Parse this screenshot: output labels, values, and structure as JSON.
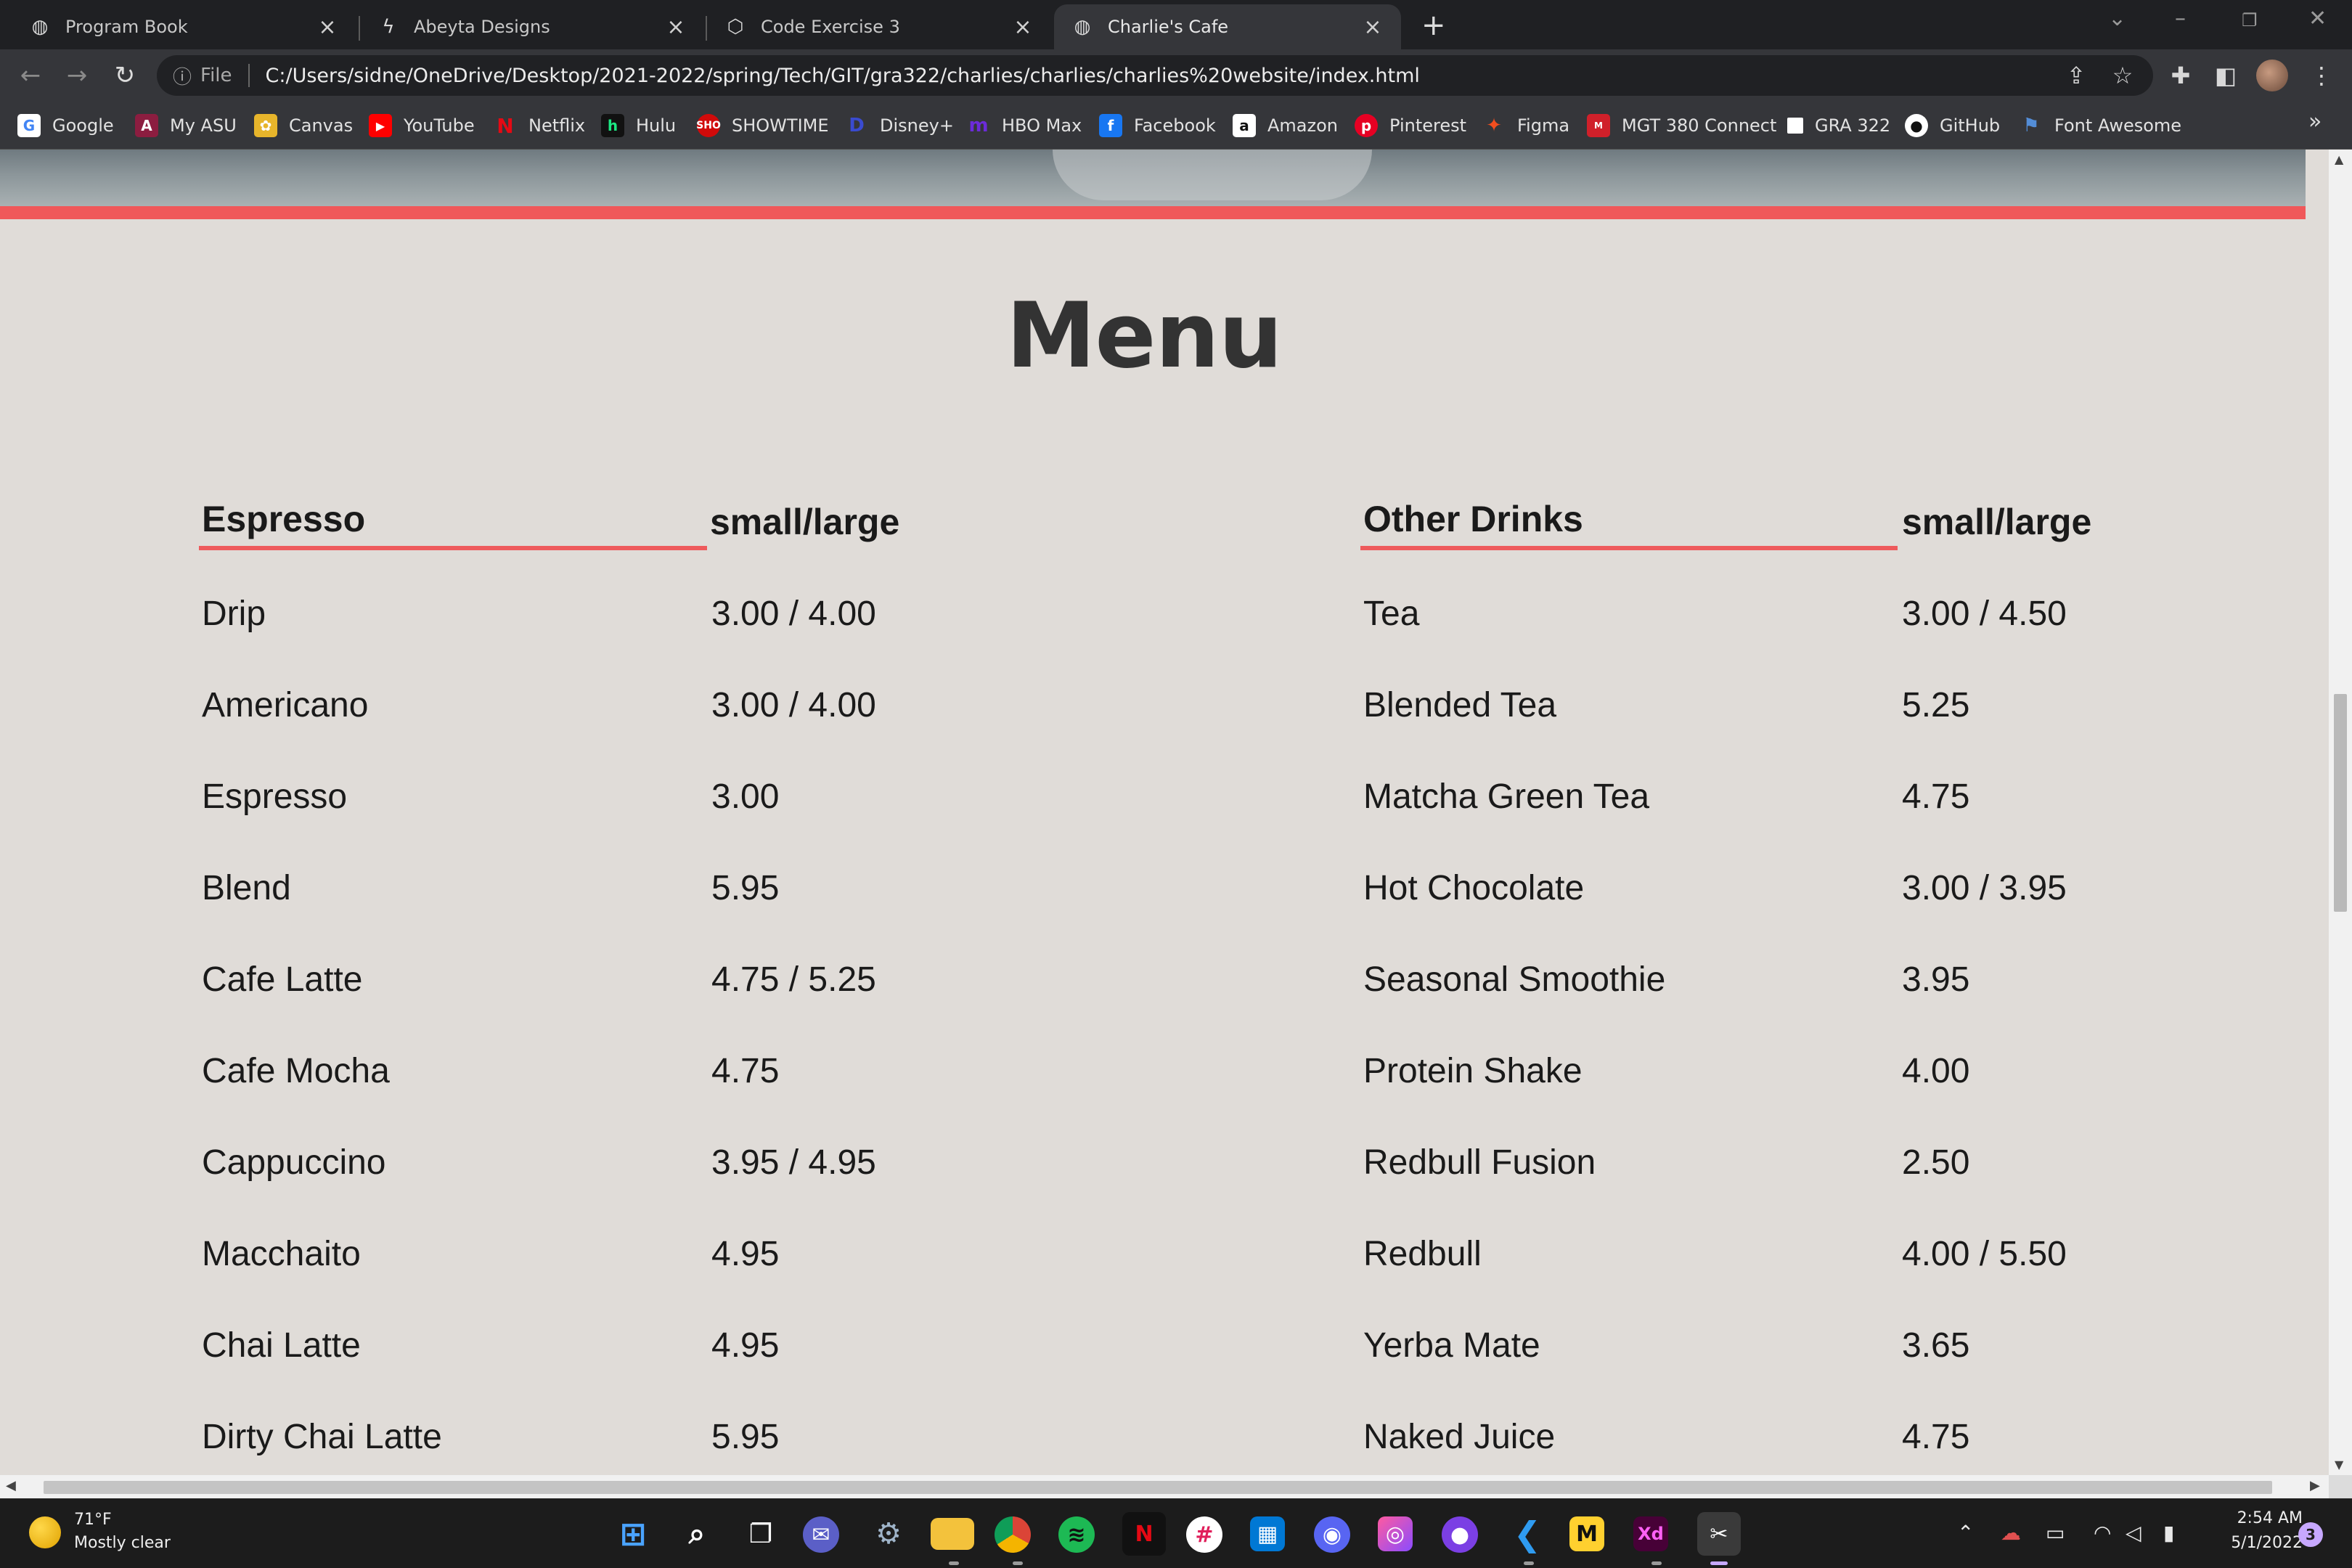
{
  "browser": {
    "tabs": [
      {
        "title": "Program Book",
        "icon": "globe-icon",
        "active": false
      },
      {
        "title": "Abeyta Designs",
        "icon": "bolt-icon",
        "active": false
      },
      {
        "title": "Code Exercise 3",
        "icon": "codepen-icon",
        "active": false
      },
      {
        "title": "Charlie's Cafe",
        "icon": "globe-icon",
        "active": true
      }
    ],
    "address": {
      "scheme_label": "File",
      "url": "C:/Users/sidne/OneDrive/Desktop/2021-2022/spring/Tech/GIT/gra322/charlies/charlies/charlies%20website/index.html"
    },
    "bookmarks": [
      {
        "label": "Google",
        "icon": "google-icon",
        "color": "#ffffff"
      },
      {
        "label": "My ASU",
        "icon": "asu-icon",
        "color": "#8c1d40"
      },
      {
        "label": "Canvas",
        "icon": "canvas-icon",
        "color": "#e7b52b"
      },
      {
        "label": "YouTube",
        "icon": "youtube-icon",
        "color": "#ff0000"
      },
      {
        "label": "Netflix",
        "icon": "netflix-icon",
        "color": "#e50914"
      },
      {
        "label": "Hulu",
        "icon": "hulu-icon",
        "color": "#1ce783"
      },
      {
        "label": "SHOWTIME",
        "icon": "showtime-icon",
        "color": "#d10a0a"
      },
      {
        "label": "Disney+",
        "icon": "disney-icon",
        "color": "#1a2a8c"
      },
      {
        "label": "HBO Max",
        "icon": "hbomax-icon",
        "color": "#6b2bd9"
      },
      {
        "label": "Facebook",
        "icon": "facebook-icon",
        "color": "#1877f2"
      },
      {
        "label": "Amazon",
        "icon": "amazon-icon",
        "color": "#ffffff"
      },
      {
        "label": "Pinterest",
        "icon": "pinterest-icon",
        "color": "#e60023"
      },
      {
        "label": "Figma",
        "icon": "figma-icon",
        "color": "#f24e1e"
      },
      {
        "label": "MGT 380 Connect",
        "icon": "mgt-icon",
        "color": "#d0202a"
      },
      {
        "label": "GRA 322",
        "icon": "page-icon",
        "color": "#ffffff"
      },
      {
        "label": "GitHub",
        "icon": "github-icon",
        "color": "#ffffff"
      },
      {
        "label": "Font Awesome",
        "icon": "flag-icon",
        "color": "#538dd7"
      }
    ],
    "bookmarks_overflow": "»"
  },
  "page": {
    "title": "Menu",
    "accent_color": "#f0585a",
    "espresso": {
      "heading": "Espresso",
      "size_heading": "small/large",
      "items": [
        {
          "name": "Drip",
          "price": "3.00 / 4.00"
        },
        {
          "name": "Americano",
          "price": "3.00 / 4.00"
        },
        {
          "name": "Espresso",
          "price": "3.00"
        },
        {
          "name": "Blend",
          "price": "5.95"
        },
        {
          "name": "Cafe Latte",
          "price": "4.75 / 5.25"
        },
        {
          "name": "Cafe Mocha",
          "price": "4.75"
        },
        {
          "name": "Cappuccino",
          "price": "3.95 / 4.95"
        },
        {
          "name": "Macchaito",
          "price": "4.95"
        },
        {
          "name": "Chai Latte",
          "price": "4.95"
        },
        {
          "name": "Dirty Chai Latte",
          "price": "5.95"
        }
      ]
    },
    "other": {
      "heading": "Other Drinks",
      "size_heading": "small/large",
      "items": [
        {
          "name": "Tea",
          "price": "3.00 / 4.50"
        },
        {
          "name": "Blended Tea",
          "price": "5.25"
        },
        {
          "name": "Matcha Green Tea",
          "price": "4.75"
        },
        {
          "name": "Hot Chocolate",
          "price": "3.00 / 3.95"
        },
        {
          "name": "Seasonal Smoothie",
          "price": "3.95"
        },
        {
          "name": "Protein Shake",
          "price": "4.00"
        },
        {
          "name": "Redbull Fusion",
          "price": "2.50"
        },
        {
          "name": "Redbull",
          "price": "4.00 / 5.50"
        },
        {
          "name": "Yerba Mate",
          "price": "3.65"
        },
        {
          "name": "Naked Juice",
          "price": "4.75"
        }
      ]
    }
  },
  "taskbar": {
    "weather": {
      "temp": "71°F",
      "desc": "Mostly clear"
    },
    "apps": [
      "windows-start-icon",
      "search-icon",
      "task-view-icon",
      "teams-chat-icon",
      "settings-icon",
      "file-explorer-icon",
      "chrome-icon",
      "spotify-icon",
      "netflix-icon",
      "slack-icon",
      "store-icon",
      "discord-icon",
      "photos-icon",
      "github-desktop-icon",
      "vscode-icon",
      "miro-icon",
      "adobe-xd-icon",
      "snipping-tool-icon"
    ],
    "clock": {
      "time": "2:54 AM",
      "date": "5/1/2022"
    },
    "notifications": "3"
  }
}
